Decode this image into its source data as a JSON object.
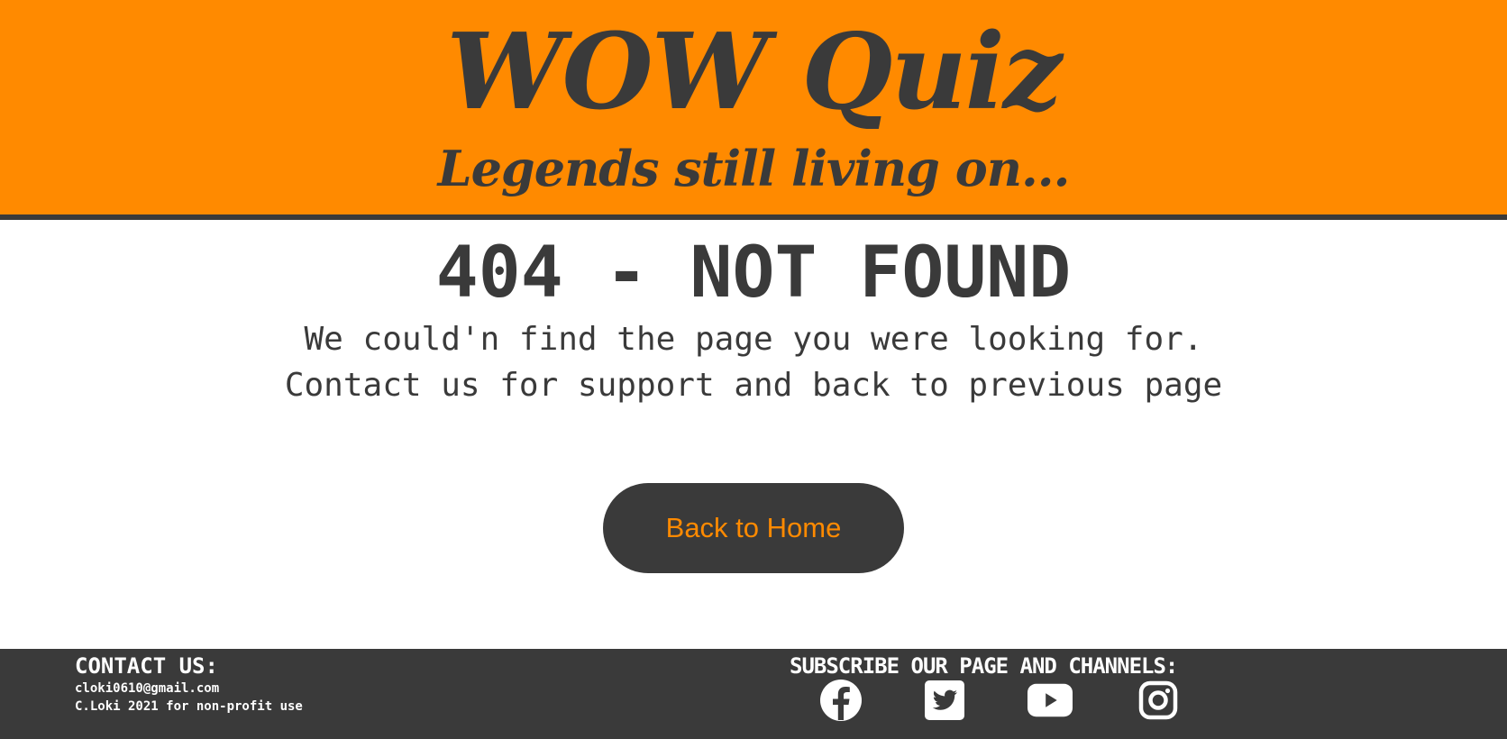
{
  "header": {
    "title": "WOW Quiz",
    "tagline": "Legends still living on..."
  },
  "main": {
    "error_title": "404 - NOT FOUND",
    "message_line1": "We could'n find the page you were looking for.",
    "message_line2": "Contact us for support and back to previous page",
    "home_button_label": "Back to Home"
  },
  "footer": {
    "contact_heading": "CONTACT US:",
    "email": "cloki0610@gmail.com",
    "copyright": "C.Loki 2021 for non-profit use",
    "subscribe_heading": "SUBSCRIBE OUR PAGE AND CHANNELS:",
    "social_icons": [
      "facebook-icon",
      "twitter-icon",
      "youtube-icon",
      "instagram-icon"
    ]
  },
  "colors": {
    "brand_orange": "#ff8a00",
    "dark_gray": "#3a3a3a",
    "white": "#ffffff"
  }
}
